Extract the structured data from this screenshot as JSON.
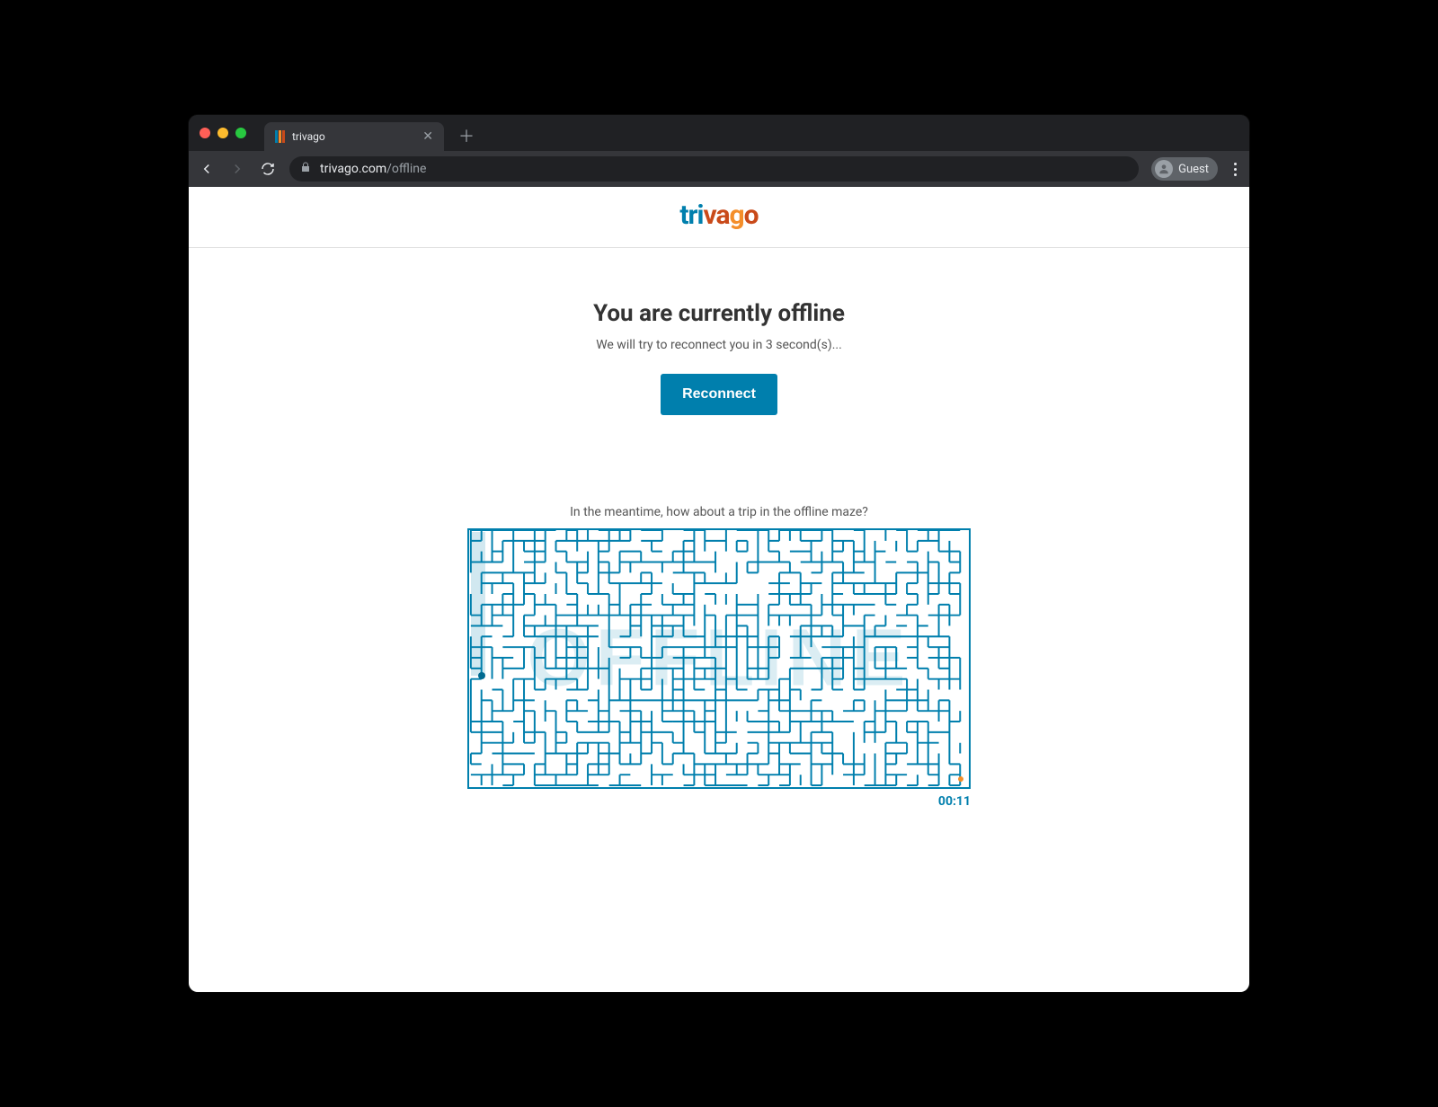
{
  "browser": {
    "tab_title": "trivago",
    "url_host": "trivago.com",
    "url_path": "/offline",
    "guest_label": "Guest"
  },
  "logo": {
    "part1": "tri",
    "part2": "va",
    "part3": "g",
    "part4": "o"
  },
  "offline": {
    "headline": "You are currently offline",
    "subtext": "We will try to reconnect you in 3 second(s)...",
    "button_label": "Reconnect"
  },
  "maze": {
    "caption": "In the meantime, how about a trip in the offline maze?",
    "word": "OFFLINE",
    "timer": "00:11"
  },
  "colors": {
    "brand_blue": "#007fad",
    "brand_orange": "#f48e2a",
    "brand_rust": "#c94a1a"
  }
}
